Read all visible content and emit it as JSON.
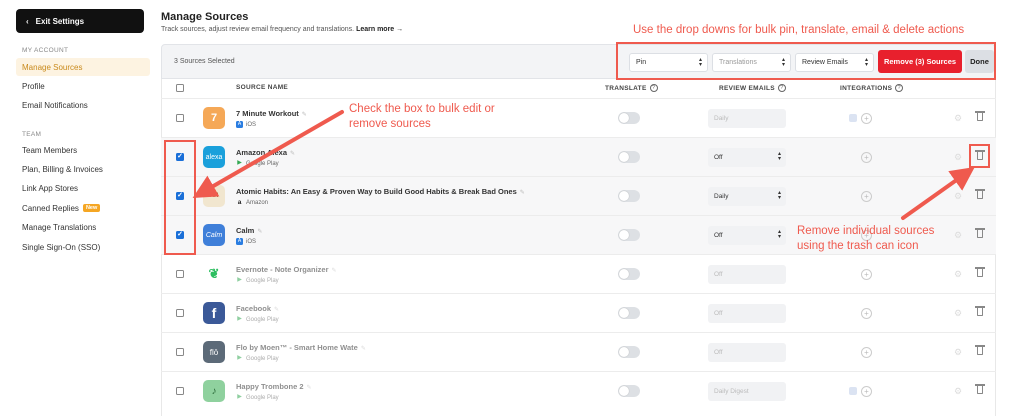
{
  "sidebar": {
    "exit_label": "Exit Settings",
    "section_account": "MY ACCOUNT",
    "section_team": "TEAM",
    "account_items": [
      {
        "label": "Manage Sources",
        "active": true
      },
      {
        "label": "Profile",
        "active": false
      },
      {
        "label": "Email Notifications",
        "active": false
      }
    ],
    "team_items": [
      {
        "label": "Team Members"
      },
      {
        "label": "Plan, Billing & Invoices"
      },
      {
        "label": "Link App Stores"
      },
      {
        "label": "Canned Replies",
        "badge": "New"
      },
      {
        "label": "Manage Translations"
      },
      {
        "label": "Single Sign-On (SSO)"
      }
    ]
  },
  "header": {
    "title": "Manage Sources",
    "subtitle": "Track sources, adjust review email frequency and translations.",
    "learn_more": "Learn more →"
  },
  "toolbar": {
    "selected_text": "3 Sources Selected",
    "pin_label": "Pin",
    "translations_label": "Translations",
    "review_emails_label": "Review Emails",
    "remove_label": "Remove (3) Sources",
    "done_label": "Done"
  },
  "columns": {
    "source_name": "SOURCE NAME",
    "translate": "TRANSLATE",
    "review_emails": "REVIEW EMAILS",
    "integrations": "INTEGRATIONS"
  },
  "rows": [
    {
      "name": "7 Minute Workout",
      "store": "iOS",
      "frequency": "Daily",
      "checked": false,
      "faded": false
    },
    {
      "name": "Amazon Alexa",
      "store": "Google Play",
      "frequency": "Off",
      "checked": true,
      "faded": false
    },
    {
      "name": "Atomic Habits: An Easy & Proven Way to Build Good Habits & Break Bad Ones",
      "store": "Amazon",
      "frequency": "Daily",
      "checked": true,
      "faded": false
    },
    {
      "name": "Calm",
      "store": "iOS",
      "frequency": "Off",
      "checked": true,
      "faded": false
    },
    {
      "name": "Evernote - Note Organizer",
      "store": "Google Play",
      "frequency": "Off",
      "checked": false,
      "faded": true
    },
    {
      "name": "Facebook",
      "store": "Google Play",
      "frequency": "Off",
      "checked": false,
      "faded": true
    },
    {
      "name": "Flo by Moen™ - Smart Home Wate",
      "store": "Google Play",
      "frequency": "Off",
      "checked": false,
      "faded": true
    },
    {
      "name": "Happy Trombone 2",
      "store": "Google Play",
      "frequency": "Daily Digest",
      "checked": false,
      "faded": true
    }
  ],
  "annotations": {
    "dropdowns": "Use the drop downs for bulk pin, translate, email & delete actions",
    "checkbox_line1": "Check the box to bulk edit or",
    "checkbox_line2": "remove sources",
    "trash_line1": "Remove individual sources",
    "trash_line2": "using the trash can icon"
  },
  "colors": {
    "accent": "#c98a1c",
    "danger": "#e8202d",
    "annotation": "#ef5a4e",
    "checkbox": "#1a6fd8"
  }
}
